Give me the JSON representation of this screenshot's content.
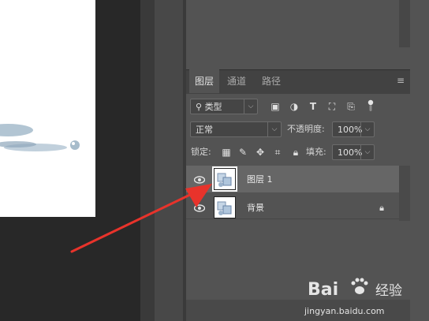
{
  "layers_panel": {
    "tabs": [
      "图层",
      "通道",
      "路径"
    ],
    "filter": {
      "label": "类型"
    },
    "blend_mode": "正常",
    "opacity_label": "不透明度:",
    "opacity_value": "100%",
    "lock_label": "锁定:",
    "fill_label": "填充:",
    "fill_value": "100%",
    "layers": [
      {
        "name": "图层 1",
        "visible": true,
        "selected": true,
        "locked": false
      },
      {
        "name": "背景",
        "visible": true,
        "selected": false,
        "locked": true
      }
    ]
  },
  "watermark": {
    "brand": "Bai",
    "brand2": "经验",
    "url": "jingyan.baidu.com"
  },
  "colors": {
    "panel_bg": "#535353",
    "selected_row": "#666666",
    "arrow": "#e8332b"
  }
}
